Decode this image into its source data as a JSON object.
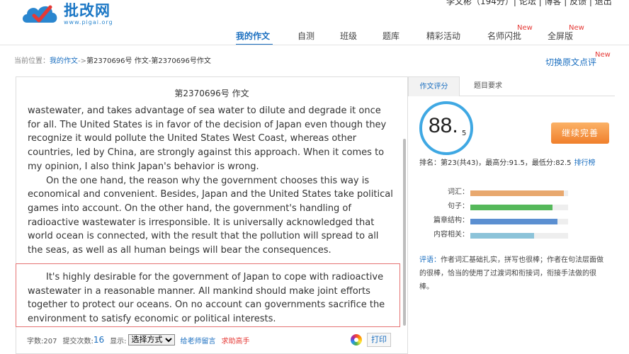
{
  "header": {
    "logo_text": "批改网",
    "logo_url": "www.pigai.org",
    "top_right": "李文彬（194分）| 论坛 | 博客 | 反馈 | 退出"
  },
  "nav": {
    "items": [
      {
        "label": "我的作文",
        "active": true,
        "badge": ""
      },
      {
        "label": "自测",
        "active": false,
        "badge": ""
      },
      {
        "label": "班级",
        "active": false,
        "badge": ""
      },
      {
        "label": "题库",
        "active": false,
        "badge": ""
      },
      {
        "label": "精彩活动",
        "active": false,
        "badge": ""
      },
      {
        "label": "名师闪批",
        "active": false,
        "badge": "New"
      },
      {
        "label": "全屏版",
        "active": false,
        "badge": "New"
      }
    ]
  },
  "breadcrumb": {
    "prefix": "当前位置：",
    "link": "我的作文",
    "separator": "->",
    "current": "第2370696号 作文-第2370696号作文"
  },
  "switch_view": {
    "label": "切换原文点评",
    "badge": "New"
  },
  "essay": {
    "title": "第2370696号 作文",
    "paragraphs": [
      {
        "text": "wastewater, and takes advantage of sea water to dilute and degrade it once for all. The United States is in favor of the decision of Japan even though they recognize it would pollute the United States West Coast, whereas other countries, led by China, are strongly against this approach. When it comes to my opinion, I also think Japan's behavior is wrong.",
        "continuation": true
      },
      {
        "text": "On the one hand, the reason why the government chooses this way is economical and convenient. Besides, Japan and the United States take political games into account. On the other hand, the government's handling of radioactive wastewater is irresponsible. It is universally acknowledged that world ocean is connected, with the result that the pollution will spread to all the seas, as well as all human beings will bear the consequences.",
        "continuation": false
      }
    ],
    "highlighted": "It's highly desirable for the government of Japan to cope with radioactive wastewater in a reasonable manner. All mankind should make joint efforts together to protect our oceans. On no account can governments sacrifice the environment to satisfy economic or political interests."
  },
  "footer": {
    "word_count": "字数:207",
    "submit_label": "提交次数:",
    "submit_count": "16",
    "display_label": "显示:",
    "display_select": "选择方式",
    "teacher_link": "给老师留言",
    "expert_link": "求助高手",
    "print_label": "打印"
  },
  "right": {
    "tabs": [
      "作文评分",
      "题目要求"
    ],
    "score_int": "88.",
    "score_dec": "5",
    "continue_label": "继续完善",
    "rank_text": "排名：第23(共43)，最高分:91.5，最低分:82.5",
    "rank_link": "排行榜",
    "bars": [
      {
        "label": "词汇：",
        "value": 0.96,
        "color": "#e8a86e"
      },
      {
        "label": "句子：",
        "value": 0.84,
        "color": "#55b85a"
      },
      {
        "label": "篇章结构：",
        "value": 0.89,
        "color": "#5b8fd1"
      },
      {
        "label": "内容相关：",
        "value": 0.65,
        "color": "#8cc3d9"
      }
    ],
    "comment_label": "评语：",
    "comment_text": "作者词汇基础扎实，拼写也很棒；作者在句法层面做的很棒，恰当的使用了过渡词和衔接词，衔接手法做的很棒。"
  }
}
